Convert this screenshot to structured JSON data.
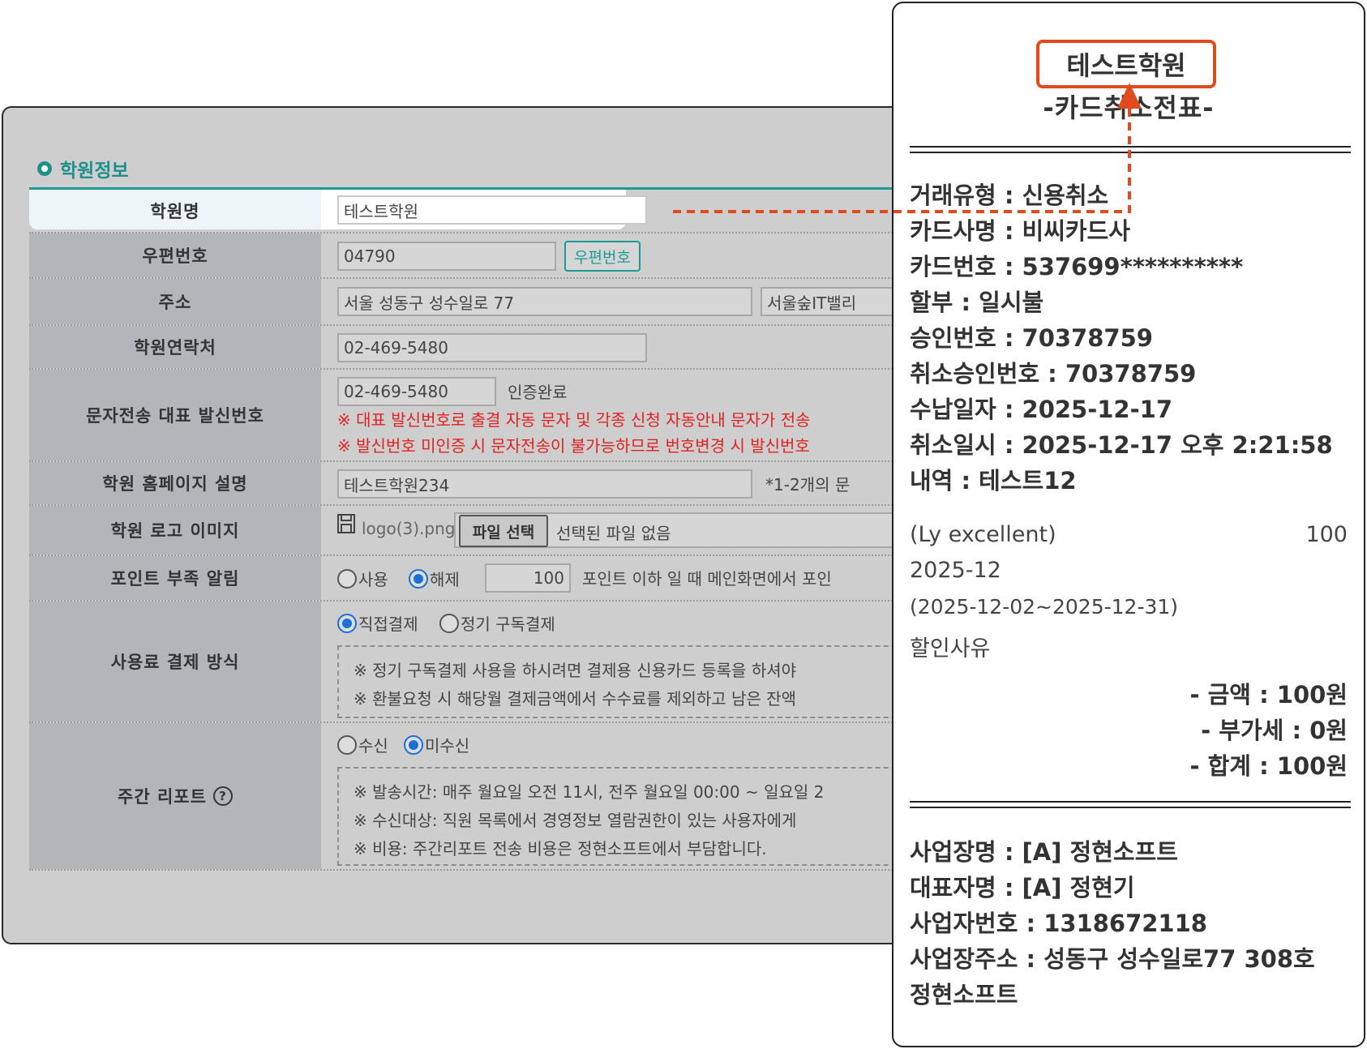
{
  "section": {
    "title": "학원정보"
  },
  "rows": {
    "name": {
      "label": "학원명",
      "value": "테스트학원"
    },
    "zip": {
      "label": "우편번호",
      "value": "04790",
      "button": "우편번호"
    },
    "address": {
      "label": "주소",
      "value1": "서울 성동구 성수일로 77",
      "value2": "서울숲IT밸리"
    },
    "phone": {
      "label": "학원연락처",
      "value": "02-469-5480"
    },
    "sms": {
      "label": "문자전송 대표 발신번호",
      "value": "02-469-5480",
      "status": "인증완료",
      "warn1": "※ 대표 발신번호로 출결 자동 문자 및 각종 신청 자동안내 문자가 전송",
      "warn2": "※ 발신번호 미인증 시 문자전송이 불가능하므로 번호변경 시 발신번호"
    },
    "homepage": {
      "label": "학원 홈페이지 설명",
      "value": "테스트학원234",
      "hint": "*1-2개의 문"
    },
    "logo": {
      "label": "학원 로고 이미지",
      "filename": "logo(3).png",
      "button": "파일 선택",
      "status": "선택된 파일 없음"
    },
    "point": {
      "label": "포인트 부족 알림",
      "option_on": "사용",
      "option_off": "해제",
      "selected": "해제",
      "value": "100",
      "desc": "포인트 이하 일 때 메인화면에서 포인"
    },
    "payment": {
      "label": "사용료 결제 방식",
      "option_direct": "직접결제",
      "option_sub": "정기 구독결제",
      "selected": "직접결제",
      "note1": "※ 정기 구독결제 사용을 하시려면 결제용 신용카드 등록을 하셔야",
      "note2": "※ 환불요청 시 해당월 결제금액에서 수수료를 제외하고 남은 잔액"
    },
    "weekly": {
      "label": "주간 리포트",
      "help": "?",
      "option_recv": "수신",
      "option_norecv": "미수신",
      "selected": "미수신",
      "note1": "※ 발송시간: 매주 월요일 오전 11시, 전주 월요일 00:00 ~ 일요일 2",
      "note2": "※ 수신대상: 직원 목록에서 경영정보 열람권한이 있는 사용자에게",
      "note3": "※ 비용: 주간리포트 전송 비용은 정현소프트에서 부담합니다."
    }
  },
  "receipt": {
    "academy": "테스트학원",
    "subtitle": "-카드취소전표-",
    "lines": [
      "거래유형 : 신용취소",
      "카드사명 : 비씨카드사",
      "카드번호 : 537699**********",
      "할부 : 일시불",
      "승인번호 : 70378759",
      "취소승인번호 : 70378759",
      "수납일자 : 2025-12-17",
      "취소일시 : 2025-12-17 오후 2:21:58",
      "내역 : 테스트12"
    ],
    "item_name": "(Ly excellent)",
    "item_amount": "100",
    "item_month": "2025-12",
    "item_period": "(2025-12-02~2025-12-31)",
    "discount_reason": "할인사유",
    "amount": "- 금액 : 100원",
    "vat": "- 부가세 : 0원",
    "total": "- 합계 : 100원",
    "biz_lines": [
      "사업장명 : [A] 정현소프트",
      "대표자명 : [A] 정현기",
      "사업자번호 : 1318672118",
      "사업장주소 : 성동구 성수일로77 308호",
      "정현소프트"
    ]
  },
  "colors": {
    "accent": "#1c9a94",
    "highlight": "#e04a1c",
    "warning": "#e02222"
  }
}
